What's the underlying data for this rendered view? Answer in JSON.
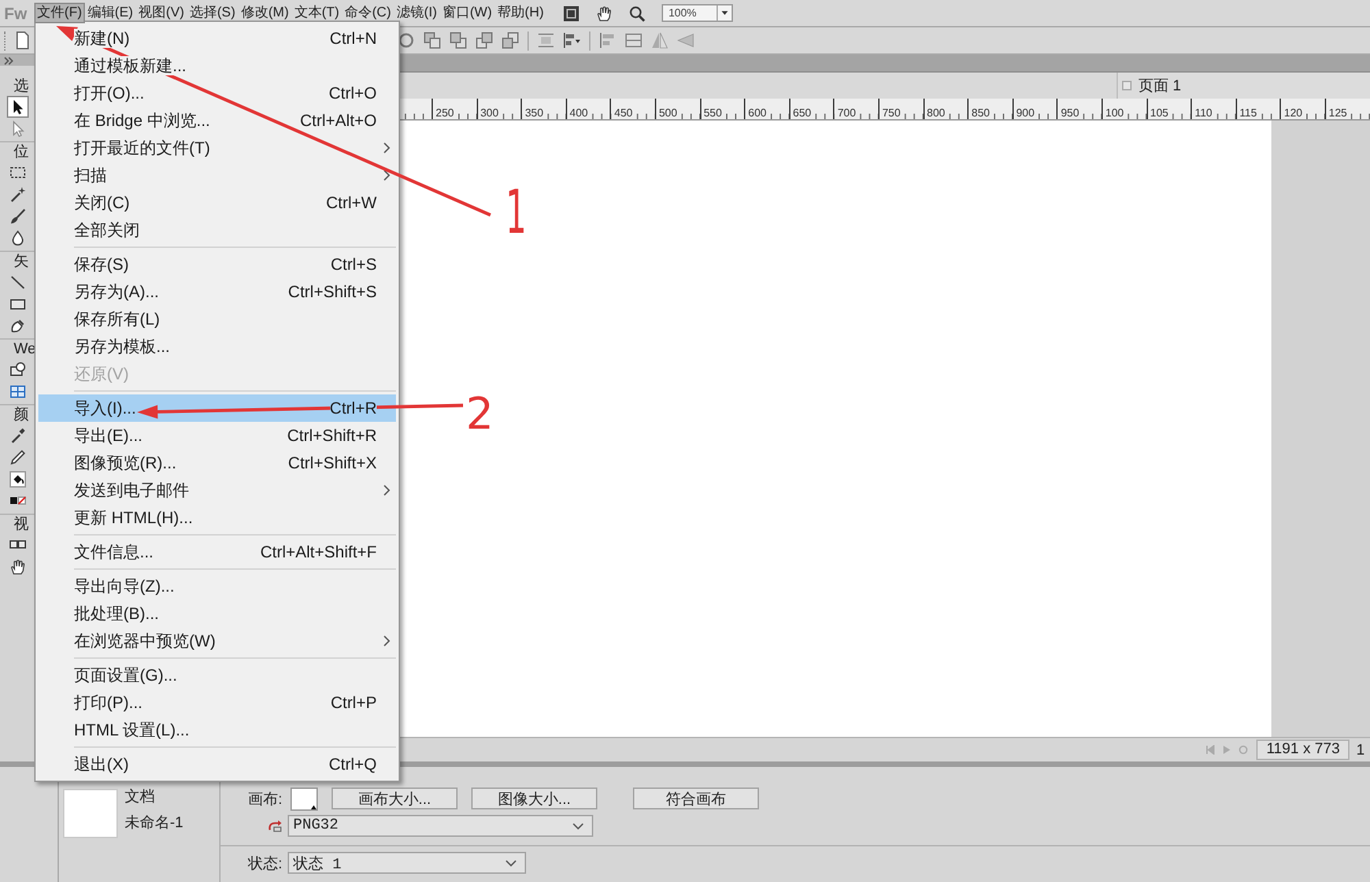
{
  "menu_bar": {
    "logo": "Fw",
    "items": [
      {
        "label": "文件(F)",
        "selected": true
      },
      {
        "label": "编辑(E)",
        "selected": false
      },
      {
        "label": "视图(V)",
        "selected": false
      },
      {
        "label": "选择(S)",
        "selected": false
      },
      {
        "label": "修改(M)",
        "selected": false
      },
      {
        "label": "文本(T)",
        "selected": false
      },
      {
        "label": "命令(C)",
        "selected": false
      },
      {
        "label": "滤镜(I)",
        "selected": false
      },
      {
        "label": "窗口(W)",
        "selected": false
      },
      {
        "label": "帮助(H)",
        "selected": false
      }
    ],
    "zoom": "100%"
  },
  "file_menu": {
    "items": [
      {
        "kind": "item",
        "label": "新建(N)",
        "shortcut": "Ctrl+N",
        "submenu": false,
        "disabled": false,
        "selected": false
      },
      {
        "kind": "item",
        "label": "通过模板新建...",
        "submenu": false,
        "disabled": false,
        "selected": false
      },
      {
        "kind": "item",
        "label": "打开(O)...",
        "shortcut": "Ctrl+O",
        "submenu": false,
        "disabled": false,
        "selected": false
      },
      {
        "kind": "item",
        "label": "在 Bridge 中浏览...",
        "shortcut": "Ctrl+Alt+O",
        "submenu": false,
        "disabled": false,
        "selected": false
      },
      {
        "kind": "item",
        "label": "打开最近的文件(T)",
        "submenu": true,
        "disabled": false,
        "selected": false
      },
      {
        "kind": "item",
        "label": "扫描",
        "submenu": true,
        "disabled": false,
        "selected": false
      },
      {
        "kind": "item",
        "label": "关闭(C)",
        "shortcut": "Ctrl+W",
        "submenu": false,
        "disabled": false,
        "selected": false
      },
      {
        "kind": "item",
        "label": "全部关闭",
        "submenu": false,
        "disabled": false,
        "selected": false
      },
      {
        "kind": "separator"
      },
      {
        "kind": "item",
        "label": "保存(S)",
        "shortcut": "Ctrl+S",
        "submenu": false,
        "disabled": false,
        "selected": false
      },
      {
        "kind": "item",
        "label": "另存为(A)...",
        "shortcut": "Ctrl+Shift+S",
        "submenu": false,
        "disabled": false,
        "selected": false
      },
      {
        "kind": "item",
        "label": "保存所有(L)",
        "submenu": false,
        "disabled": false,
        "selected": false
      },
      {
        "kind": "item",
        "label": "另存为模板...",
        "submenu": false,
        "disabled": false,
        "selected": false
      },
      {
        "kind": "item",
        "label": "还原(V)",
        "submenu": false,
        "disabled": true,
        "selected": false
      },
      {
        "kind": "separator"
      },
      {
        "kind": "item",
        "label": "导入(I)...",
        "shortcut": "Ctrl+R",
        "submenu": false,
        "disabled": false,
        "selected": true
      },
      {
        "kind": "item",
        "label": "导出(E)...",
        "shortcut": "Ctrl+Shift+R",
        "submenu": false,
        "disabled": false,
        "selected": false
      },
      {
        "kind": "item",
        "label": "图像预览(R)...",
        "shortcut": "Ctrl+Shift+X",
        "submenu": false,
        "disabled": false,
        "selected": false
      },
      {
        "kind": "item",
        "label": "发送到电子邮件",
        "submenu": true,
        "disabled": false,
        "selected": false
      },
      {
        "kind": "item",
        "label": "更新 HTML(H)...",
        "submenu": false,
        "disabled": false,
        "selected": false
      },
      {
        "kind": "separator"
      },
      {
        "kind": "item",
        "label": "文件信息...",
        "shortcut": "Ctrl+Alt+Shift+F",
        "submenu": false,
        "disabled": false,
        "selected": false
      },
      {
        "kind": "separator"
      },
      {
        "kind": "item",
        "label": "导出向导(Z)...",
        "submenu": false,
        "disabled": false,
        "selected": false
      },
      {
        "kind": "item",
        "label": "批处理(B)...",
        "submenu": false,
        "disabled": false,
        "selected": false
      },
      {
        "kind": "item",
        "label": "在浏览器中预览(W)",
        "submenu": true,
        "disabled": false,
        "selected": false
      },
      {
        "kind": "separator"
      },
      {
        "kind": "item",
        "label": "页面设置(G)...",
        "submenu": false,
        "disabled": false,
        "selected": false
      },
      {
        "kind": "item",
        "label": "打印(P)...",
        "shortcut": "Ctrl+P",
        "submenu": false,
        "disabled": false,
        "selected": false
      },
      {
        "kind": "item",
        "label": "HTML 设置(L)...",
        "submenu": false,
        "disabled": false,
        "selected": false
      },
      {
        "kind": "separator"
      },
      {
        "kind": "item",
        "label": "退出(X)",
        "shortcut": "Ctrl+Q",
        "submenu": false,
        "disabled": false,
        "selected": false
      }
    ]
  },
  "tools_panel": {
    "sections": [
      {
        "label": "选",
        "tools": [
          {
            "kind": "pointer",
            "selected": true
          },
          {
            "kind": "subselect",
            "selected": false
          }
        ]
      },
      {
        "label": "位",
        "tools": [
          {
            "kind": "marquee",
            "selected": false
          },
          {
            "kind": "wand",
            "selected": false
          },
          {
            "kind": "brush",
            "selected": false
          },
          {
            "kind": "blur",
            "selected": false
          }
        ]
      },
      {
        "label": "矢",
        "tools": [
          {
            "kind": "line",
            "selected": false
          },
          {
            "kind": "rectangle",
            "selected": false
          },
          {
            "kind": "pen",
            "selected": false
          }
        ]
      },
      {
        "label": "We",
        "tools": [
          {
            "kind": "hotspot",
            "selected": false
          },
          {
            "kind": "slice",
            "selected": false
          }
        ]
      },
      {
        "label": "颜",
        "tools": [
          {
            "kind": "eyedropper",
            "selected": false
          },
          {
            "kind": "pencil",
            "selected": false
          },
          {
            "kind": "fill",
            "selected": false
          },
          {
            "kind": "colors",
            "selected": false
          }
        ]
      },
      {
        "label": "视",
        "tools": [
          {
            "kind": "screen",
            "selected": false
          },
          {
            "kind": "hand",
            "selected": false
          }
        ]
      }
    ]
  },
  "document": {
    "page": "页面 1",
    "ruler_labels": [
      "250",
      "300",
      "350",
      "400",
      "450",
      "500",
      "550",
      "600",
      "650",
      "700",
      "750",
      "800",
      "850",
      "900",
      "950",
      "100",
      "105",
      "110",
      "115",
      "120",
      "125"
    ],
    "size": "1191 x 773",
    "status_value": "1"
  },
  "properties": {
    "title": "文档",
    "name": "未命名-1",
    "canvas_label": "画布:",
    "buttons": [
      "画布大小...",
      "图像大小...",
      "符合画布"
    ],
    "format": "PNG32",
    "state_label": "状态:",
    "state": "状态 1"
  },
  "annotations": [
    {
      "label": "1"
    },
    {
      "label": "2"
    }
  ]
}
